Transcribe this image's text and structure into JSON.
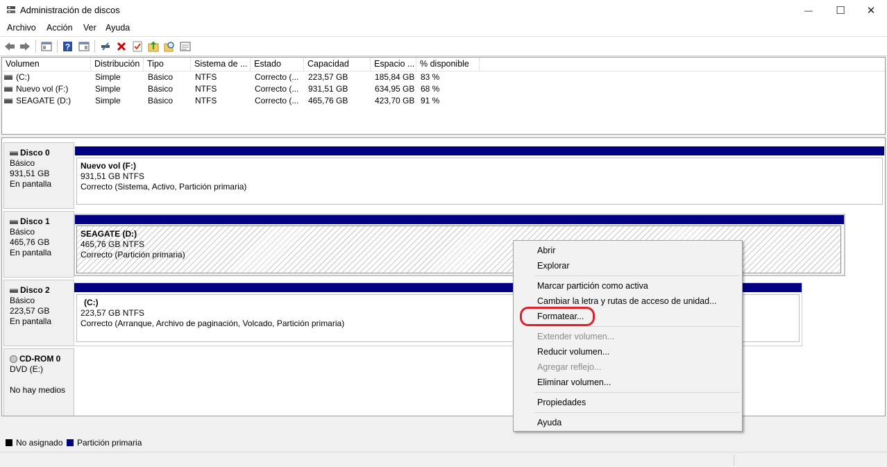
{
  "window": {
    "title": "Administración de discos",
    "minimize": "—",
    "maximize": "☐",
    "close": "✕"
  },
  "menu": [
    "Archivo",
    "Acción",
    "Ver",
    "Ayuda"
  ],
  "toolbar": {
    "icons": [
      "back-arrow-icon",
      "forward-arrow-icon",
      "console-tree-icon",
      "help-icon",
      "properties-icon",
      "connect-disk-icon",
      "delete-icon",
      "check-icon",
      "folder-up-icon",
      "search-icon",
      "details-icon"
    ],
    "colors": {
      "delete": "#d00000",
      "help": "#2b4fa8"
    }
  },
  "list": {
    "columns": [
      "Volumen",
      "Distribución",
      "Tipo",
      "Sistema de ...",
      "Estado",
      "Capacidad",
      "Espacio ...",
      "% disponible"
    ],
    "rows": [
      [
        "(C:)",
        "Simple",
        "Básico",
        "NTFS",
        "Correcto (...",
        "223,57 GB",
        "185,84 GB",
        "83 %"
      ],
      [
        "Nuevo vol (F:)",
        "Simple",
        "Básico",
        "NTFS",
        "Correcto (...",
        "931,51 GB",
        "634,95 GB",
        "68 %"
      ],
      [
        "SEAGATE (D:)",
        "Simple",
        "Básico",
        "NTFS",
        "Correcto (...",
        "465,76 GB",
        "423,70 GB",
        "91 %"
      ]
    ]
  },
  "disks": [
    {
      "name": "Disco 0",
      "type": "Básico",
      "size": "931,51 GB",
      "status": "En pantalla",
      "partition": {
        "name": "Nuevo vol  (F:)",
        "size": "931,51 GB NTFS",
        "status": "Correcto (Sistema, Activo, Partición primaria)"
      }
    },
    {
      "name": "Disco 1",
      "type": "Básico",
      "size": "465,76 GB",
      "status": "En pantalla",
      "partition": {
        "name": "SEAGATE  (D:)",
        "size": "465,76 GB NTFS",
        "status": "Correcto (Partición primaria)"
      }
    },
    {
      "name": "Disco 2",
      "type": "Básico",
      "size": "223,57 GB",
      "status": "En pantalla",
      "partition": {
        "name": "(C:)",
        "size": "223,57 GB NTFS",
        "status": "Correcto (Arranque, Archivo de paginación, Volcado, Partición primaria)"
      }
    },
    {
      "name": "CD-ROM 0",
      "type": "DVD (E:)",
      "size": "",
      "status": "No hay medios"
    }
  ],
  "legend": [
    {
      "label": "No asignado",
      "color": "#000000"
    },
    {
      "label": "Partición primaria",
      "color": "#000080"
    }
  ],
  "context_menu": {
    "items": [
      {
        "label": "Abrir",
        "enabled": true
      },
      {
        "label": "Explorar",
        "enabled": true
      },
      {
        "label": "Marcar partición como activa",
        "enabled": true
      },
      {
        "label": "Cambiar la letra y rutas de acceso de unidad...",
        "enabled": true
      },
      {
        "label": "Formatear...",
        "enabled": true,
        "highlighted": true
      },
      {
        "label": "Extender volumen...",
        "enabled": false
      },
      {
        "label": "Reducir volumen...",
        "enabled": true
      },
      {
        "label": "Agregar reflejo...",
        "enabled": false
      },
      {
        "label": "Eliminar volumen...",
        "enabled": true
      },
      {
        "label": "Propiedades",
        "enabled": true
      },
      {
        "label": "Ayuda",
        "enabled": true
      }
    ],
    "highlight_color": "#e0202a"
  }
}
